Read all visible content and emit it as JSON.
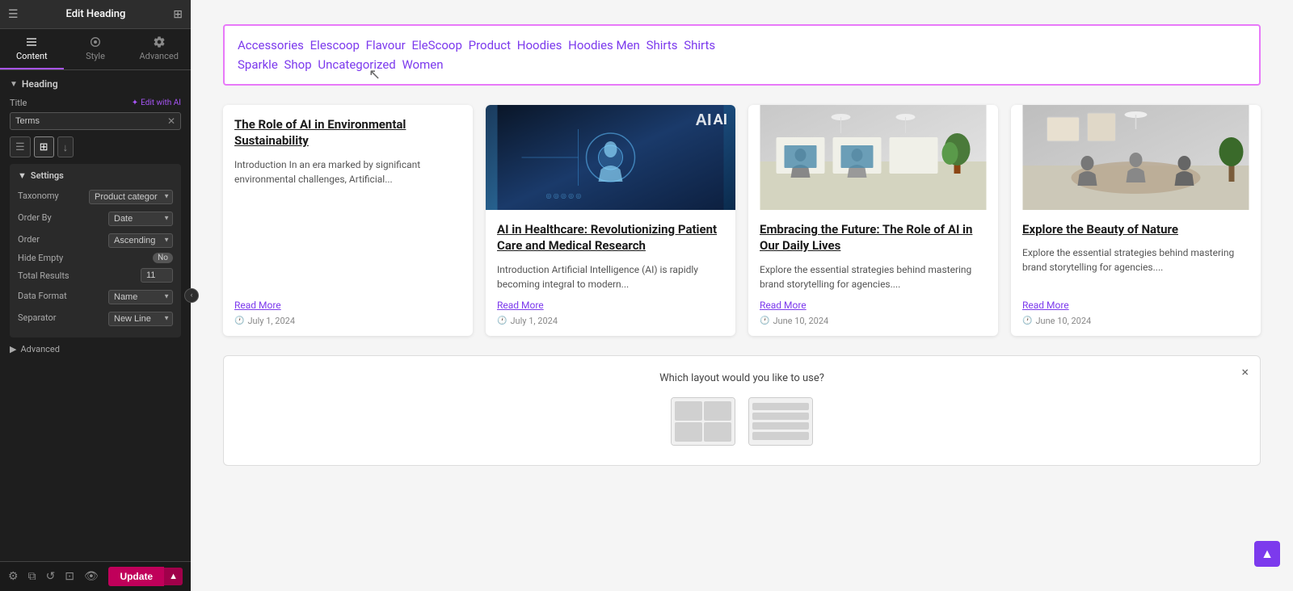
{
  "panel": {
    "title": "Edit Heading",
    "tabs": [
      {
        "id": "content",
        "label": "Content",
        "active": true
      },
      {
        "id": "style",
        "label": "Style",
        "active": false
      },
      {
        "id": "advanced",
        "label": "Advanced",
        "active": false
      }
    ],
    "heading_section": "Heading",
    "title_label": "Title",
    "edit_with_ai": "Edit with AI",
    "title_value": "Terms",
    "settings": {
      "heading": "Settings",
      "taxonomy_label": "Taxonomy",
      "taxonomy_value": "Product categor",
      "order_by_label": "Order By",
      "order_by_value": "Date",
      "order_label": "Order",
      "order_value": "Ascending",
      "hide_empty_label": "Hide Empty",
      "hide_empty_value": "No",
      "total_results_label": "Total Results",
      "total_results_value": "11",
      "data_format_label": "Data Format",
      "data_format_value": "Name",
      "separator_label": "Separator",
      "separator_value": "New Line"
    },
    "advanced_label": "Advanced",
    "update_label": "Update"
  },
  "canvas": {
    "categories": [
      "Accessories",
      "Elescoop",
      "Flavour",
      "EleScoop",
      "Product",
      "Hoodies",
      "Hoodies Men",
      "Shirts",
      "Shirts Sparkle",
      "Shop",
      "Uncategorized",
      "Women"
    ],
    "posts": [
      {
        "id": 1,
        "title": "The Role of AI in Environmental Sustainability",
        "excerpt": "Introduction In an era marked by significant environmental challenges, Artificial...",
        "read_more": "Read More",
        "date": "July 1, 2024",
        "has_image": false,
        "img_type": "none"
      },
      {
        "id": 2,
        "title": "AI in Healthcare: Revolutionizing Patient Care and Medical Research",
        "excerpt": "Introduction Artificial Intelligence (AI) is rapidly becoming integral to modern...",
        "read_more": "Read More",
        "date": "July 1, 2024",
        "has_image": true,
        "img_type": "ai"
      },
      {
        "id": 3,
        "title": "Embracing the Future: The Role of AI in Our Daily Lives",
        "excerpt": "Explore the essential strategies behind mastering brand storytelling for agencies....",
        "read_more": "Read More",
        "date": "June 10, 2024",
        "has_image": true,
        "img_type": "office"
      },
      {
        "id": 4,
        "title": "Explore the Beauty of Nature",
        "excerpt": "Explore the essential strategies behind mastering brand storytelling for agencies....",
        "read_more": "Read More",
        "date": "June 10, 2024",
        "has_image": true,
        "img_type": "office2"
      }
    ],
    "layout_dialog": {
      "title": "Which layout would you like to use?",
      "close": "×"
    }
  },
  "footer": {
    "update_label": "Update"
  }
}
